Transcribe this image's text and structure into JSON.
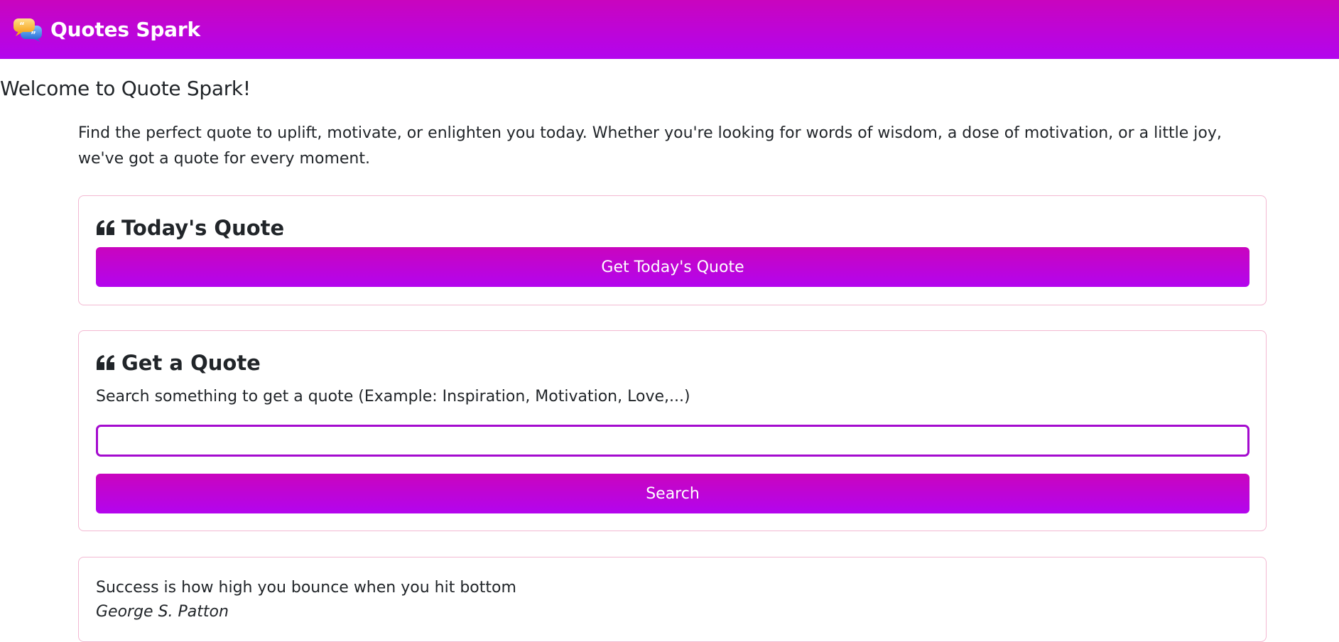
{
  "header": {
    "brand": "Quotes Spark",
    "logo_icon": "chat-bubbles-icon",
    "gradient_top": "#c905be",
    "gradient_bottom": "#b305ee"
  },
  "main": {
    "welcome_title": "Welcome to Quote Spark!",
    "intro": "Find the perfect quote to uplift, motivate, or enlighten you today. Whether you're looking for words of wisdom, a dose of motivation, or a little joy, we've got a quote for every moment."
  },
  "today_card": {
    "title": "Today's Quote",
    "icon": "quote-left-icon",
    "button_label": "Get Today's Quote"
  },
  "search_card": {
    "title": "Get a Quote",
    "icon": "quote-left-icon",
    "label": "Search something to get a quote (Example: Inspiration, Motivation, Love,...)",
    "input_value": "",
    "button_label": "Search"
  },
  "result_card": {
    "quote": "Success is how high you bounce when you hit bottom",
    "author": "George S. Patton"
  }
}
